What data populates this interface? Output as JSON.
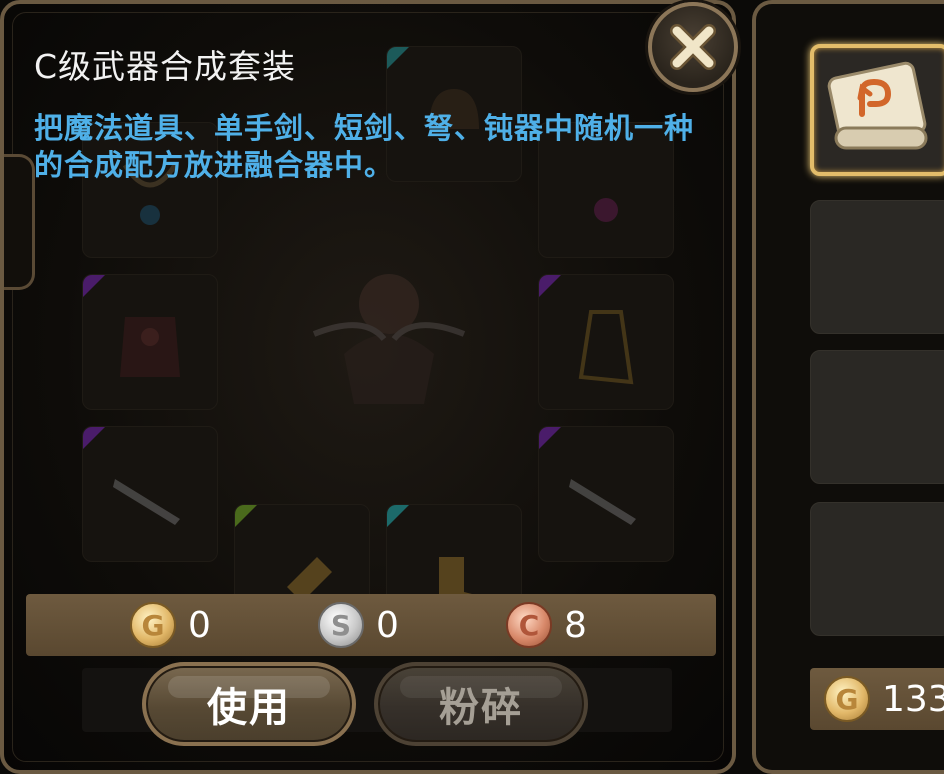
{
  "panel": {
    "title": "C级武器合成套装",
    "description": "把魔法道具、单手剑、短剑、弩、钝器中随机一种的合成配方放进融合器中。"
  },
  "currency": {
    "gold": {
      "icon_letter": "G",
      "value": "0"
    },
    "silver": {
      "icon_letter": "S",
      "value": "0"
    },
    "copper": {
      "icon_letter": "C",
      "value": "8"
    }
  },
  "buttons": {
    "use_label": "使用",
    "smash_label": "粉碎"
  },
  "inventory": {
    "gold_icon_letter": "G",
    "gold_value": "133"
  },
  "colors": {
    "description_text": "#4fb0e8",
    "panel_border": "#6b5a42",
    "selected_slot_border": "#e3bd6a",
    "currency_bar": "#6e5a3f"
  },
  "icons": {
    "close": "close-x-icon",
    "recipe": "recipe-scroll-icon"
  }
}
